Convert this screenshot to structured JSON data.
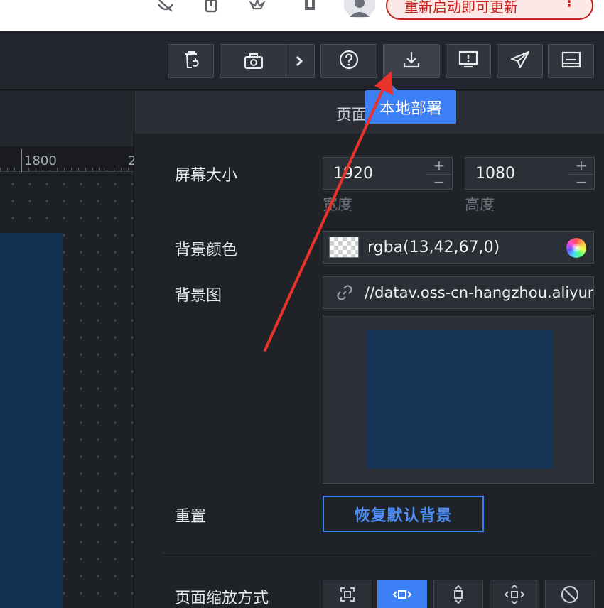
{
  "browser": {
    "update_label": "重新启动即可更新",
    "menu_dots": "⋮"
  },
  "toolbar": {
    "buttons": [
      {
        "name": "recycle",
        "icon": "trash-refresh-icon"
      },
      {
        "name": "snapshot",
        "icon": "camera-icon",
        "dropdown_icon": "chevron-right-icon"
      },
      {
        "name": "help",
        "icon": "help-circle-icon"
      },
      {
        "name": "local-deploy",
        "icon": "download-icon"
      },
      {
        "name": "preview",
        "icon": "monitor-alert-icon"
      },
      {
        "name": "publish",
        "icon": "send-icon"
      },
      {
        "name": "more",
        "icon": "panel-icon"
      }
    ],
    "tooltip": "本地部署"
  },
  "canvas": {
    "ruler_label": "1800",
    "ruler_label_cut": "2",
    "screen_color": "#12304f"
  },
  "panel": {
    "tab_label": "页面",
    "screen_size": {
      "label": "屏幕大小",
      "width": "1920",
      "height": "1080",
      "width_caption": "宽度",
      "height_caption": "高度",
      "plus": "+",
      "minus": "−"
    },
    "bg_color": {
      "label": "背景颜色",
      "value": "rgba(13,42,67,0)"
    },
    "bg_image": {
      "label": "背景图",
      "url": "//datav.oss-cn-hangzhou.aliyuncs.com",
      "preview_color": "#163456"
    },
    "reset": {
      "label": "重置",
      "button": "恢复默认背景"
    },
    "scale": {
      "label": "页面缩放方式",
      "options": [
        "fit-full",
        "fit-width",
        "fit-height",
        "fit-center",
        "no-scale"
      ],
      "active_index": 1
    }
  },
  "colors": {
    "accent": "#3d7ff5",
    "annotation_arrow": "#e8322b"
  }
}
